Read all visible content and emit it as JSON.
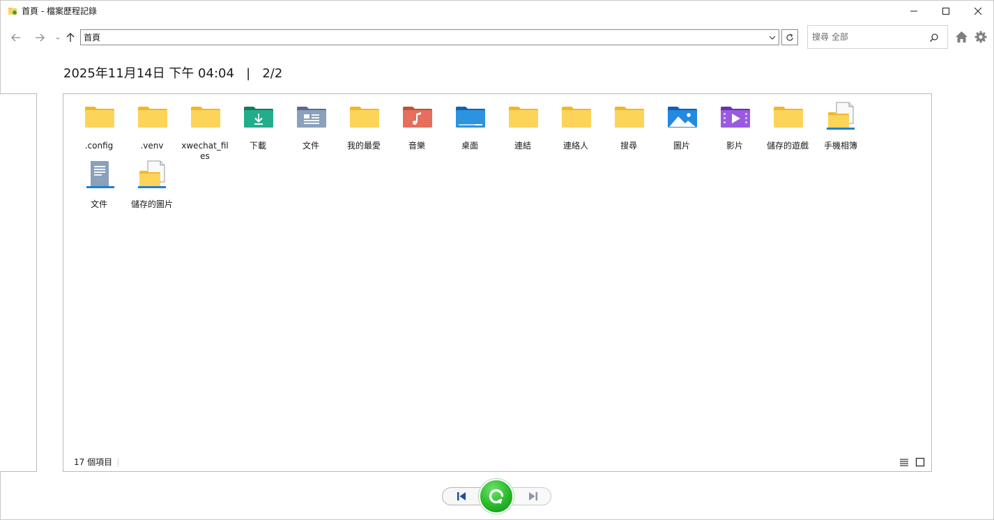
{
  "window": {
    "title": "首頁 - 檔案歷程記錄"
  },
  "navigation": {
    "address": "首頁",
    "search_placeholder": "搜尋 全部"
  },
  "timestamp": "2025年11月14日 下午 04:04   |   2/2",
  "files": [
    {
      "label": ".config",
      "icon": "folder-icon"
    },
    {
      "label": ".venv",
      "icon": "folder-icon"
    },
    {
      "label": "xwechat_files",
      "icon": "folder-icon"
    },
    {
      "label": "下載",
      "icon": "downloads-folder-icon"
    },
    {
      "label": "文件",
      "icon": "documents-folder-icon"
    },
    {
      "label": "我的最愛",
      "icon": "folder-icon"
    },
    {
      "label": "音樂",
      "icon": "music-folder-icon"
    },
    {
      "label": "桌面",
      "icon": "desktop-folder-icon"
    },
    {
      "label": "連結",
      "icon": "folder-icon"
    },
    {
      "label": "連絡人",
      "icon": "folder-icon"
    },
    {
      "label": "搜尋",
      "icon": "folder-icon"
    },
    {
      "label": "圖片",
      "icon": "pictures-folder-icon"
    },
    {
      "label": "影片",
      "icon": "videos-folder-icon"
    },
    {
      "label": "儲存的遊戲",
      "icon": "folder-icon"
    },
    {
      "label": "手機相簿",
      "icon": "library-icon"
    },
    {
      "label": "文件",
      "icon": "documents-library-icon"
    },
    {
      "label": "儲存的圖片",
      "icon": "library-icon"
    }
  ],
  "status": {
    "item_count": "17 個項目"
  },
  "colors": {
    "folder_yellow": "#f9c842",
    "restore_green": "#27b82a",
    "downloads_teal": "#1ea886",
    "music_red": "#e0695a",
    "pictures_blue": "#1f88dc",
    "videos_purple": "#8b52d6"
  }
}
